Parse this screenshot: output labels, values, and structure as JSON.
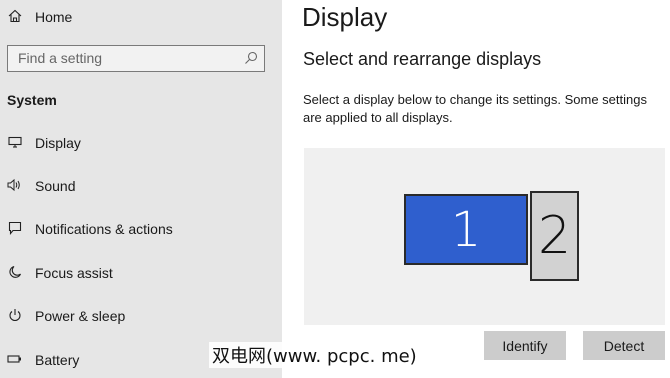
{
  "sidebar": {
    "home_label": "Home",
    "search_placeholder": "Find a setting",
    "section_title": "System",
    "items": [
      {
        "label": "Display",
        "icon": "monitor-icon"
      },
      {
        "label": "Sound",
        "icon": "speaker-icon"
      },
      {
        "label": "Notifications & actions",
        "icon": "notifications-icon"
      },
      {
        "label": "Focus assist",
        "icon": "moon-icon"
      },
      {
        "label": "Power & sleep",
        "icon": "power-icon"
      },
      {
        "label": "Battery",
        "icon": "battery-icon"
      }
    ]
  },
  "main": {
    "title": "Display",
    "subheading": "Select and rearrange displays",
    "description": "Select a display below to change its settings. Some settings are applied to all displays.",
    "monitors": [
      {
        "number": "1",
        "selected": true
      },
      {
        "number": "2",
        "selected": false
      }
    ],
    "identify_label": "Identify",
    "detect_label": "Detect"
  },
  "watermark": "双电网(www. pcpc. me)",
  "colors": {
    "sidebar_bg": "#e6e6e6",
    "selected_monitor": "#2f5fce",
    "unselected_monitor": "#d2d2d2",
    "button_bg": "#cccccc"
  }
}
